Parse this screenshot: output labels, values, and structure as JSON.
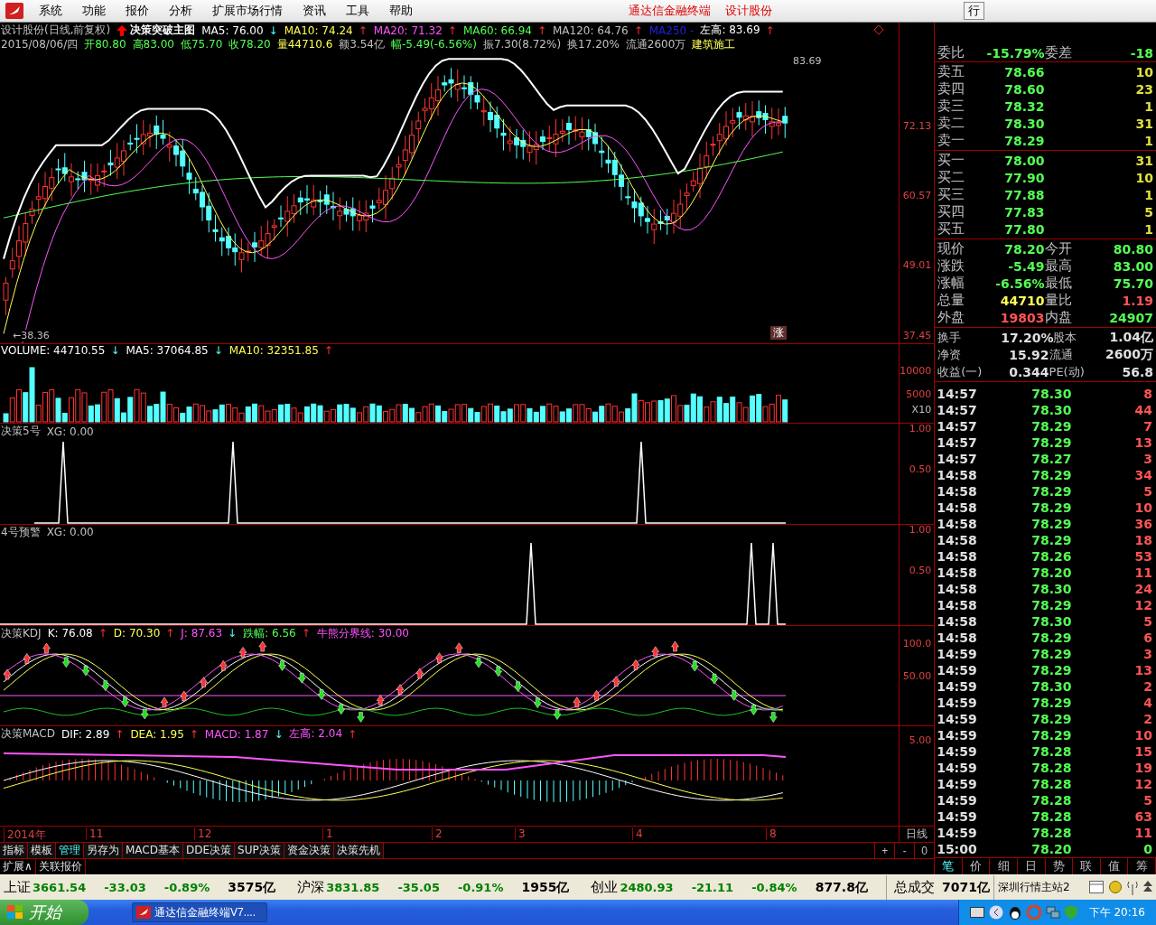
{
  "menu_bar": {
    "items": [
      "系统",
      "功能",
      "报价",
      "分析",
      "扩展市场行情",
      "资讯",
      "工具",
      "帮助"
    ],
    "title": "通达信金融终端",
    "stock": "设计股份",
    "right_button": "行"
  },
  "panes": [
    {
      "kind": "candles",
      "header_rows": [
        [
          {
            "text": "设计股份(日线,前复权)",
            "color": "#c0c0c0",
            "kind": "value"
          },
          {
            "text": "决策突破主图",
            "color": "#ffffff",
            "kind": "marker"
          },
          {
            "text": "MA5: 76.00",
            "color": "#ffffff",
            "kind": "value",
            "arrow": "↓"
          },
          {
            "text": "MA10: 74.24",
            "color": "#ffff54",
            "kind": "value",
            "arrow": "↑"
          },
          {
            "text": "MA20: 71.32",
            "color": "#ff54ff",
            "kind": "value",
            "arrow": "↑"
          },
          {
            "text": "MA60: 66.94",
            "color": "#54ff54",
            "kind": "value",
            "arrow": "↑"
          },
          {
            "text": "MA120: 64.76",
            "color": "#c0c0c0",
            "kind": "value",
            "arrow": "↑"
          },
          {
            "text": "MA250 -",
            "color": "#2020e0",
            "kind": "value"
          },
          {
            "text": "左高: 83.69",
            "color": "#ffffff",
            "kind": "value",
            "arrow": "↑"
          }
        ],
        [
          {
            "text": "2015/08/06/四",
            "color": "#c0c0c0",
            "kind": "value"
          },
          {
            "text": "开80.80",
            "color": "#54ff54",
            "kind": "value"
          },
          {
            "text": "高83.00",
            "color": "#54ff54",
            "kind": "value"
          },
          {
            "text": "低75.70",
            "color": "#54ff54",
            "kind": "value"
          },
          {
            "text": "收78.20",
            "color": "#54ff54",
            "kind": "value"
          },
          {
            "text": "量44710.6",
            "color": "#ffff54",
            "kind": "value"
          },
          {
            "text": "额3.54亿",
            "color": "#c0c0c0",
            "kind": "value"
          },
          {
            "text": "幅-5.49(-6.56%)",
            "color": "#54ff54",
            "kind": "value"
          },
          {
            "text": "振7.30(8.72%)",
            "color": "#c0c0c0",
            "kind": "value"
          },
          {
            "text": "换17.20%",
            "color": "#c0c0c0",
            "kind": "value"
          },
          {
            "text": "流通2600万",
            "color": "#c0c0c0",
            "kind": "value"
          },
          {
            "text": "建筑施工",
            "color": "#ffff54",
            "kind": "value"
          }
        ]
      ],
      "axis": [
        "72.13",
        "60.57",
        "49.01",
        "37.45"
      ],
      "high_label": "83.69",
      "low_label": "←38.36",
      "tags": [
        "涨"
      ]
    },
    {
      "kind": "volume",
      "header_rows": [
        [
          {
            "text": "VOLUME: 44710.55",
            "color": "#ffffff",
            "kind": "value",
            "arrow": "↓"
          },
          {
            "text": "MA5: 37064.85",
            "color": "#ffffff",
            "kind": "value",
            "arrow": "↓"
          },
          {
            "text": "MA10: 32351.85",
            "color": "#ffff54",
            "kind": "value",
            "arrow": "↑"
          }
        ]
      ],
      "axis": [
        "10000",
        "5000",
        "X10"
      ]
    },
    {
      "kind": "spikes",
      "header_rows": [
        [
          {
            "text": "决策5号",
            "color": "#c0c0c0",
            "kind": "value"
          },
          {
            "text": "XG: 0.00",
            "color": "#c0c0c0",
            "kind": "value"
          }
        ]
      ],
      "axis": [
        "1.00",
        "0.50"
      ]
    },
    {
      "kind": "spikes",
      "header_rows": [
        [
          {
            "text": "4号预警",
            "color": "#c0c0c0",
            "kind": "value"
          },
          {
            "text": "XG: 0.00",
            "color": "#c0c0c0",
            "kind": "value"
          }
        ]
      ],
      "axis": [
        "1.00",
        "0.50"
      ]
    },
    {
      "kind": "kdj",
      "header_rows": [
        [
          {
            "text": "决策KDJ",
            "color": "#c0c0c0",
            "kind": "value"
          },
          {
            "text": "K: 76.08",
            "color": "#ffffff",
            "kind": "value",
            "arrow": "↑"
          },
          {
            "text": "D: 70.30",
            "color": "#ffff54",
            "kind": "value",
            "arrow": "↑"
          },
          {
            "text": "J: 87.63",
            "color": "#ff54ff",
            "kind": "value",
            "arrow": "↓"
          },
          {
            "text": "跌幅: 6.56",
            "color": "#54ff54",
            "kind": "value",
            "arrow": "↑"
          },
          {
            "text": "牛熊分界线: 30.00",
            "color": "#ff54ff",
            "kind": "value"
          }
        ]
      ],
      "axis": [
        "100.0",
        "50.00"
      ]
    },
    {
      "kind": "macd",
      "header_rows": [
        [
          {
            "text": "决策MACD",
            "color": "#c0c0c0",
            "kind": "value"
          },
          {
            "text": "DIF: 2.89",
            "color": "#ffffff",
            "kind": "value",
            "arrow": "↑"
          },
          {
            "text": "DEA: 1.95",
            "color": "#ffff54",
            "kind": "value",
            "arrow": "↑"
          },
          {
            "text": "MACD: 1.87",
            "color": "#ff54ff",
            "kind": "value",
            "arrow": "↓"
          },
          {
            "text": "左高: 2.04",
            "color": "#ff54ff",
            "kind": "value",
            "arrow": "↑"
          }
        ]
      ],
      "axis": [
        "5.00"
      ]
    }
  ],
  "date_axis": {
    "labels": [
      "2014年",
      "11",
      "12",
      "1",
      "2",
      "3",
      "4",
      "8"
    ],
    "period": "日线"
  },
  "indicator_tabs": [
    {
      "label": "指标",
      "selected": false
    },
    {
      "label": "模板",
      "selected": false
    },
    {
      "label": "管理",
      "selected": true
    },
    {
      "label": "另存为",
      "selected": false
    },
    {
      "label": "MACD基本",
      "selected": false
    },
    {
      "label": "DDE决策",
      "selected": false
    },
    {
      "label": "SUP决策",
      "selected": false
    },
    {
      "label": "资金决策",
      "selected": false
    },
    {
      "label": "决策先机",
      "selected": false
    }
  ],
  "zoom_buttons": [
    "+",
    "-",
    "0"
  ],
  "extra_tabs": [
    "扩展∧",
    "关联报价"
  ],
  "right_panel": {
    "ratio": {
      "label": "委比",
      "value": "-15.79%",
      "label2": "委差",
      "value2": "-18"
    },
    "sell": [
      {
        "label": "卖五",
        "price": "78.66",
        "qty": "10"
      },
      {
        "label": "卖四",
        "price": "78.60",
        "qty": "23"
      },
      {
        "label": "卖三",
        "price": "78.32",
        "qty": "1"
      },
      {
        "label": "卖二",
        "price": "78.30",
        "qty": "31"
      },
      {
        "label": "卖一",
        "price": "78.29",
        "qty": "1"
      }
    ],
    "buy": [
      {
        "label": "买一",
        "price": "78.00",
        "qty": "31"
      },
      {
        "label": "买二",
        "price": "77.90",
        "qty": "10"
      },
      {
        "label": "买三",
        "price": "77.88",
        "qty": "1"
      },
      {
        "label": "买四",
        "price": "77.83",
        "qty": "5"
      },
      {
        "label": "买五",
        "price": "77.80",
        "qty": "1"
      }
    ],
    "quote": [
      [
        {
          "label": "现价",
          "value": "78.20",
          "color": "#54ff54"
        },
        {
          "label": "今开",
          "value": "80.80",
          "color": "#54ff54"
        }
      ],
      [
        {
          "label": "涨跌",
          "value": "-5.49",
          "color": "#54ff54"
        },
        {
          "label": "最高",
          "value": "83.00",
          "color": "#54ff54"
        }
      ],
      [
        {
          "label": "涨幅",
          "value": "-6.56%",
          "color": "#54ff54"
        },
        {
          "label": "最低",
          "value": "75.70",
          "color": "#54ff54"
        }
      ],
      [
        {
          "label": "总量",
          "value": "44710",
          "color": "#ffff54"
        },
        {
          "label": "量比",
          "value": "1.19",
          "color": "#ff5454"
        }
      ],
      [
        {
          "label": "外盘",
          "value": "19803",
          "color": "#ff5454"
        },
        {
          "label": "内盘",
          "value": "24907",
          "color": "#54ff54"
        }
      ]
    ],
    "info": [
      [
        {
          "label": "换手",
          "value": "17.20%"
        },
        {
          "label": "股本",
          "value": "1.04亿"
        }
      ],
      [
        {
          "label": "净资",
          "value": "15.92"
        },
        {
          "label": "流通",
          "value": "2600万"
        }
      ],
      [
        {
          "label": "收益(一)",
          "value": "0.344"
        },
        {
          "label": "PE(动)",
          "value": "56.8"
        }
      ]
    ],
    "trades": [
      {
        "time": "14:57",
        "price": "78.30",
        "vol": "8",
        "color": "#ff5454"
      },
      {
        "time": "14:57",
        "price": "78.30",
        "vol": "44",
        "color": "#ff5454"
      },
      {
        "time": "14:57",
        "price": "78.29",
        "vol": "7",
        "color": "#ff5454"
      },
      {
        "time": "14:57",
        "price": "78.29",
        "vol": "13",
        "color": "#ff5454"
      },
      {
        "time": "14:57",
        "price": "78.27",
        "vol": "3",
        "color": "#ff5454"
      },
      {
        "time": "14:58",
        "price": "78.29",
        "vol": "34",
        "color": "#ff5454"
      },
      {
        "time": "14:58",
        "price": "78.29",
        "vol": "5",
        "color": "#ff5454"
      },
      {
        "time": "14:58",
        "price": "78.29",
        "vol": "10",
        "color": "#ff5454"
      },
      {
        "time": "14:58",
        "price": "78.29",
        "vol": "36",
        "color": "#ff5454"
      },
      {
        "time": "14:58",
        "price": "78.29",
        "vol": "18",
        "color": "#ff5454"
      },
      {
        "time": "14:58",
        "price": "78.26",
        "vol": "53",
        "color": "#ff5454"
      },
      {
        "time": "14:58",
        "price": "78.20",
        "vol": "11",
        "color": "#ff5454"
      },
      {
        "time": "14:58",
        "price": "78.30",
        "vol": "24",
        "color": "#ff5454"
      },
      {
        "time": "14:58",
        "price": "78.29",
        "vol": "12",
        "color": "#ff5454"
      },
      {
        "time": "14:58",
        "price": "78.30",
        "vol": "5",
        "color": "#ff5454"
      },
      {
        "time": "14:58",
        "price": "78.29",
        "vol": "6",
        "color": "#ff5454"
      },
      {
        "time": "14:59",
        "price": "78.29",
        "vol": "3",
        "color": "#ff5454"
      },
      {
        "time": "14:59",
        "price": "78.29",
        "vol": "13",
        "color": "#ff5454"
      },
      {
        "time": "14:59",
        "price": "78.30",
        "vol": "2",
        "color": "#ff5454"
      },
      {
        "time": "14:59",
        "price": "78.29",
        "vol": "4",
        "color": "#ff5454"
      },
      {
        "time": "14:59",
        "price": "78.29",
        "vol": "2",
        "color": "#ff5454"
      },
      {
        "time": "14:59",
        "price": "78.29",
        "vol": "10",
        "color": "#ff5454"
      },
      {
        "time": "14:59",
        "price": "78.28",
        "vol": "15",
        "color": "#ff5454"
      },
      {
        "time": "14:59",
        "price": "78.28",
        "vol": "19",
        "color": "#ff5454"
      },
      {
        "time": "14:59",
        "price": "78.28",
        "vol": "12",
        "color": "#ff5454"
      },
      {
        "time": "14:59",
        "price": "78.28",
        "vol": "5",
        "color": "#ff5454"
      },
      {
        "time": "14:59",
        "price": "78.28",
        "vol": "63",
        "color": "#ff5454"
      },
      {
        "time": "14:59",
        "price": "78.28",
        "vol": "11",
        "color": "#ff5454"
      },
      {
        "time": "15:00",
        "price": "78.20",
        "vol": "0",
        "color": "#54ff54"
      }
    ],
    "tabs": [
      {
        "label": "笔",
        "selected": true
      },
      {
        "label": "价",
        "selected": false
      },
      {
        "label": "细",
        "selected": false
      },
      {
        "label": "日",
        "selected": false
      },
      {
        "label": "势",
        "selected": false
      },
      {
        "label": "联",
        "selected": false
      },
      {
        "label": "值",
        "selected": false
      },
      {
        "label": "筹",
        "selected": false
      }
    ]
  },
  "index_bar": {
    "indices": [
      {
        "name": "上证",
        "value": "3661.54",
        "change": "-33.03",
        "pct": "-0.89%",
        "amount": "3575亿"
      },
      {
        "name": "沪深",
        "value": "3831.85",
        "change": "-35.05",
        "pct": "-0.91%",
        "amount": "1955亿"
      },
      {
        "name": "创业",
        "value": "2480.93",
        "change": "-21.11",
        "pct": "-0.84%",
        "amount": "877.8亿"
      }
    ],
    "total_label": "总成交",
    "total_value": "7071亿",
    "server": "深圳行情主站2"
  },
  "taskbar": {
    "start": "开始",
    "task": "通达信金融终端V7....",
    "clock": "下午 20:16"
  }
}
